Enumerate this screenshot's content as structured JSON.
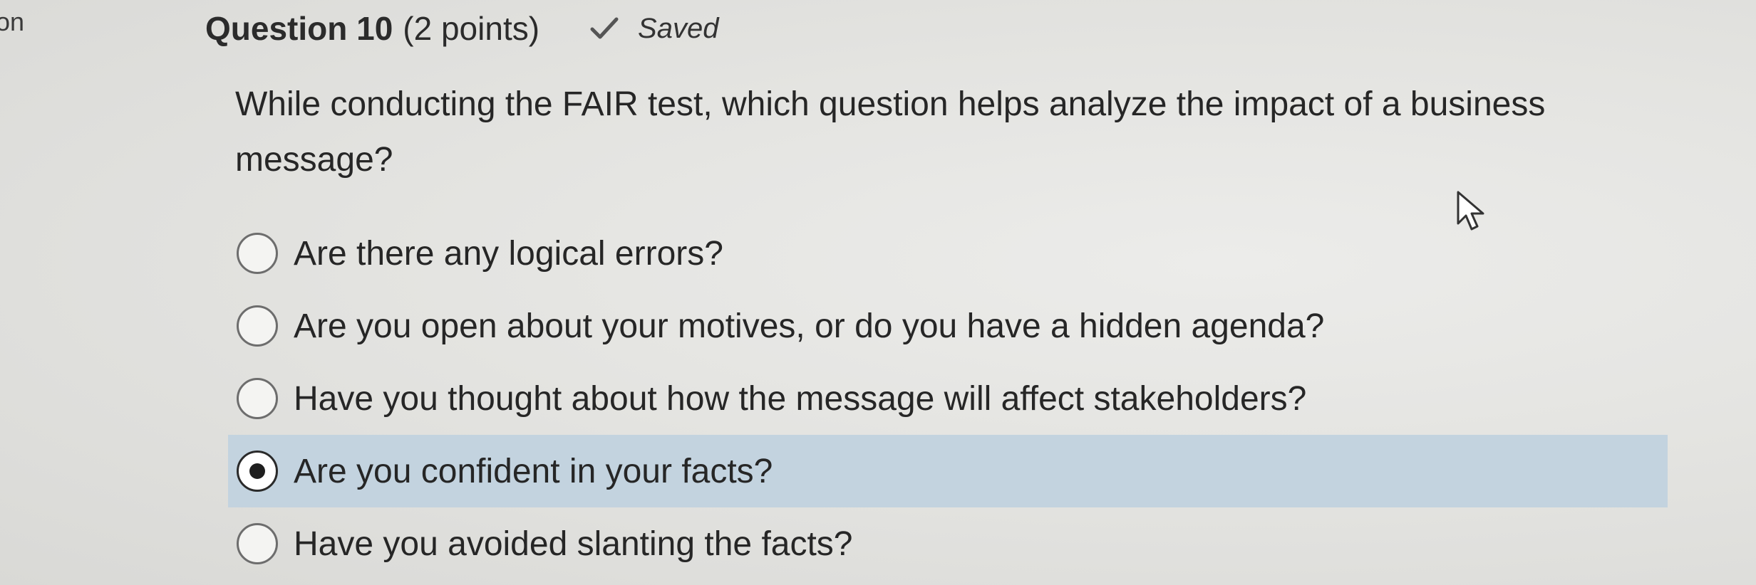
{
  "sidebar": {
    "partial_label": "ion"
  },
  "question": {
    "title": "Question 10",
    "points": "(2 points)",
    "saved_status": "Saved",
    "saved_icon": "checkmark-icon",
    "text": "While conducting the FAIR test, which question helps analyze the impact of a business message?"
  },
  "options": [
    {
      "label": "Are there any logical errors?",
      "selected": false
    },
    {
      "label": "Are you open about your motives, or do you have a hidden agenda?",
      "selected": false
    },
    {
      "label": "Have you thought about how the message will affect stakeholders?",
      "selected": false
    },
    {
      "label": "Are you confident in your facts?",
      "selected": true
    },
    {
      "label": "Have you avoided slanting the facts?",
      "selected": false
    }
  ],
  "colors": {
    "selected_row_background": "#c3d3df",
    "text": "#262626"
  }
}
